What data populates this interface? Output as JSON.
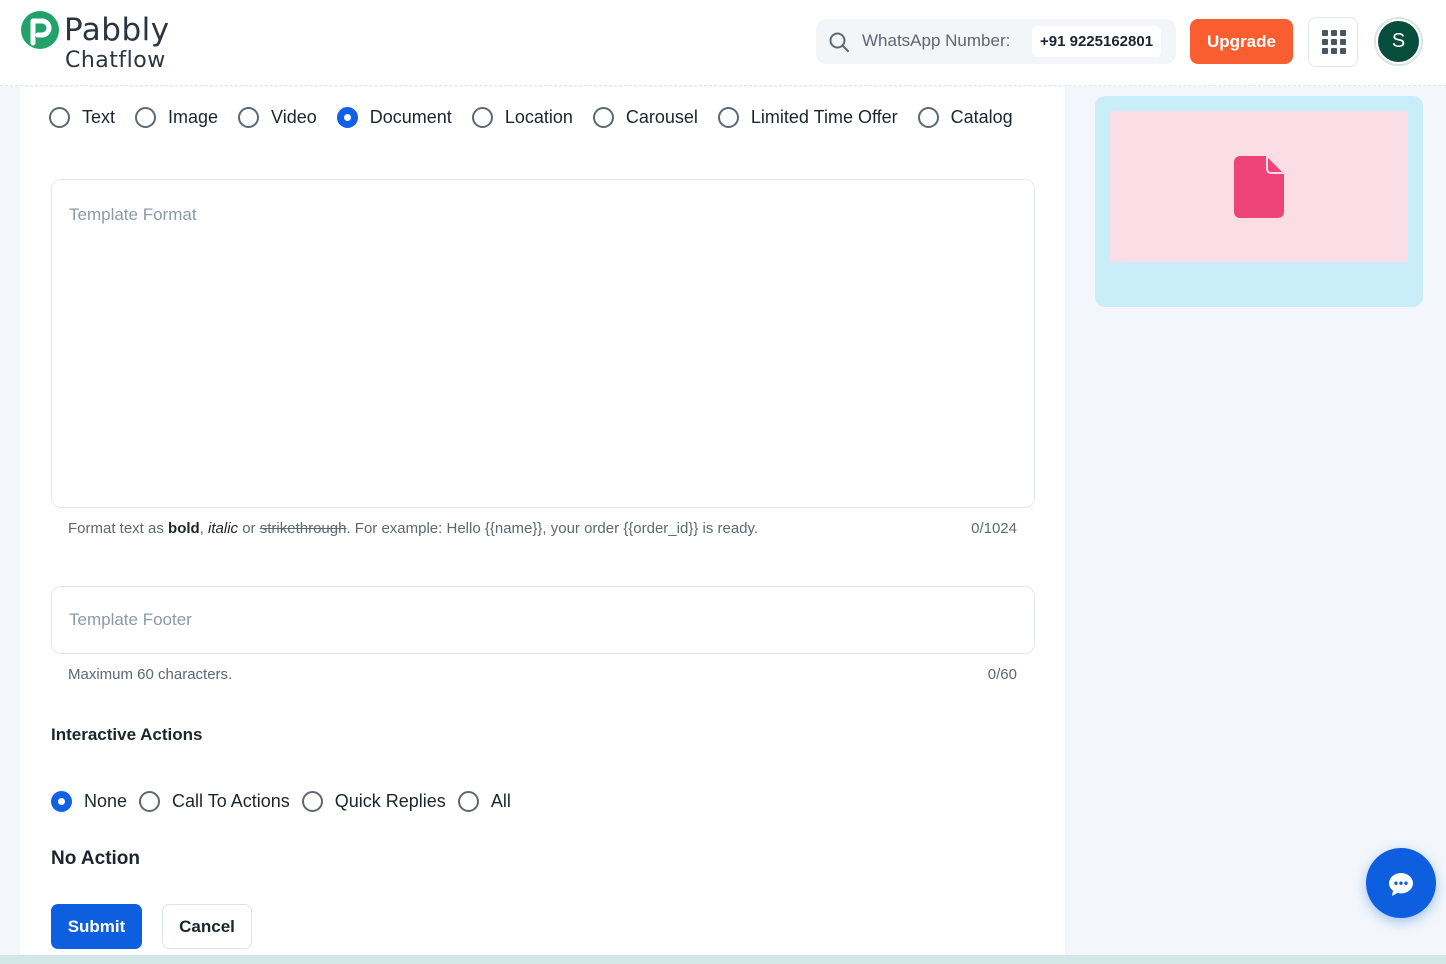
{
  "brand": {
    "name_line1": "Pabbly",
    "name_line2": "Chatflow"
  },
  "header": {
    "whatsapp_label": "WhatsApp Number:",
    "whatsapp_number": "+91 9225162801",
    "upgrade_label": "Upgrade",
    "avatar_initial": "S"
  },
  "template_types": {
    "options": [
      "Text",
      "Image",
      "Video",
      "Document",
      "Location",
      "Carousel",
      "Limited Time Offer",
      "Catalog"
    ],
    "selected": "Document"
  },
  "format_field": {
    "placeholder": "Template Format",
    "helper_prefix": "Format text as ",
    "helper_bold": "bold",
    "helper_sep": ", ",
    "helper_italic": "italic",
    "helper_or": " or ",
    "helper_strike": "strikethrough",
    "helper_suffix": ". For example: Hello {{name}}, your order {{order_id}} is ready.",
    "counter": "0/1024"
  },
  "footer_field": {
    "placeholder": "Template Footer",
    "helper": "Maximum 60 characters.",
    "counter": "0/60"
  },
  "interactive_actions": {
    "title": "Interactive Actions",
    "options": [
      "None",
      "Call To Actions",
      "Quick Replies",
      "All"
    ],
    "selected": "None",
    "result_label": "No Action"
  },
  "buttons": {
    "submit": "Submit",
    "cancel": "Cancel"
  },
  "colors": {
    "primary": "#0d5fe0",
    "upgrade": "#fa5d2f",
    "preview_bg": "#c9eef9",
    "document_bg": "#fbdde6",
    "document_icon": "#ee4479"
  }
}
